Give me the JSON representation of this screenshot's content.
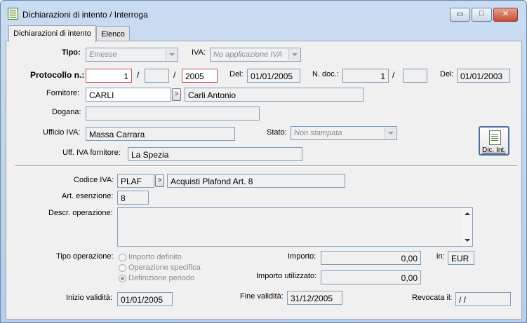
{
  "window": {
    "title": "Dichiarazioni di intento / Interroga"
  },
  "window_controls": {
    "minimize": "▭",
    "maximize": "□",
    "close": "✕"
  },
  "tabs": [
    {
      "label": "Dichiarazioni di intento"
    },
    {
      "label": "Elenco"
    }
  ],
  "form": {
    "tipo": {
      "label": "Tipo:",
      "value": "Emesse"
    },
    "iva": {
      "label": "IVA:",
      "value": "No applicazione IVA"
    },
    "protocollo": {
      "label": "Protocollo n.:",
      "number": "1",
      "slash1": "/",
      "serie": "",
      "slash2": "/",
      "year": "2005"
    },
    "del1": {
      "label": "Del:",
      "value": "01/01/2005"
    },
    "ndoc": {
      "label": "N. doc.:",
      "number": "1",
      "slash": "/",
      "serie": ""
    },
    "del2": {
      "label": "Del:",
      "value": "01/01/2003"
    },
    "fornitore": {
      "label": "Fornitore:",
      "code": "CARLI",
      "zoom": ">",
      "name": "Carli Antonio"
    },
    "dogana": {
      "label": "Dogana:",
      "value": ""
    },
    "ufficio_iva": {
      "label": "Ufficio IVA:",
      "value": "Massa Carrara"
    },
    "stato": {
      "label": "Stato:",
      "value": "Non stampata"
    },
    "uff_iva_fornitore": {
      "label": "Uff. IVA fornitore:",
      "value": "La Spezia"
    },
    "dic_int_button": {
      "label": "Dic. Int."
    },
    "codice_iva": {
      "label": "Codice IVA:",
      "code": "PLAF",
      "zoom": ">",
      "description": "Acquisti Plafond Art. 8"
    },
    "art_esenzione": {
      "label": "Art. esenzione:",
      "value": "8"
    },
    "descr_operazione": {
      "label": "Descr. operazione:",
      "value": ""
    },
    "tipo_operazione": {
      "label": "Tipo operazione:",
      "options": [
        "Importo definito",
        "Operazione specifica",
        "Definizione periodo"
      ],
      "selected_index": 2
    },
    "importo": {
      "label": "Importo:",
      "value": "0,00"
    },
    "valuta": {
      "label": "in:",
      "value": "EUR"
    },
    "importo_utilizzato": {
      "label": "Importo utilizzato:",
      "value": "0,00"
    },
    "inizio_validita": {
      "label": "Inizio validità:",
      "value": "01/01/2005"
    },
    "fine_validita": {
      "label": "Fine validità:",
      "value": "31/12/2005"
    },
    "revocata_il": {
      "label": "Revocata il:",
      "value": " /  /"
    }
  }
}
